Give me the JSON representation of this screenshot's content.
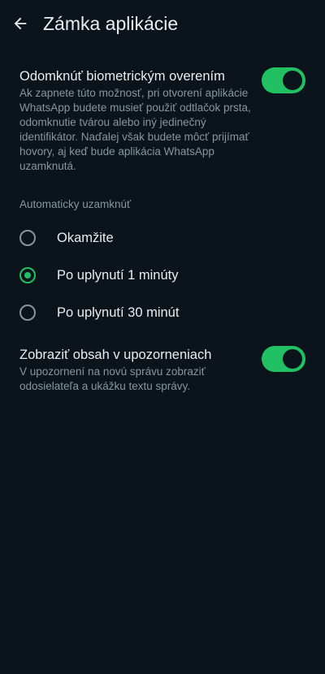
{
  "app": {
    "title": "Zámka aplikácie"
  },
  "colors": {
    "accent": "#21c063",
    "background": "#0b141b",
    "text_primary": "#e9edef",
    "text_secondary": "#8696a0"
  },
  "icons": {
    "back": "arrow-left-icon"
  },
  "biometric": {
    "title": "Odomknúť biometrickým overením",
    "description": "Ak zapnete túto možnosť, pri otvorení aplikácie WhatsApp budete musieť použiť odtlačok prsta, odomknutie tvárou alebo iný jedinečný identifikátor. Naďalej však budete môcť prijímať hovory, aj keď bude aplikácia WhatsApp uzamknutá.",
    "enabled": true
  },
  "auto_lock": {
    "label": "Automaticky uzamknúť",
    "options": [
      {
        "label": "Okamžite",
        "selected": false
      },
      {
        "label": "Po uplynutí 1 minúty",
        "selected": true
      },
      {
        "label": "Po uplynutí 30 minút",
        "selected": false
      }
    ]
  },
  "notifications": {
    "title": "Zobraziť obsah v upozorneniach",
    "description": "V upozornení na novú správu zobraziť odosielateľa a ukážku textu správy.",
    "enabled": true
  }
}
